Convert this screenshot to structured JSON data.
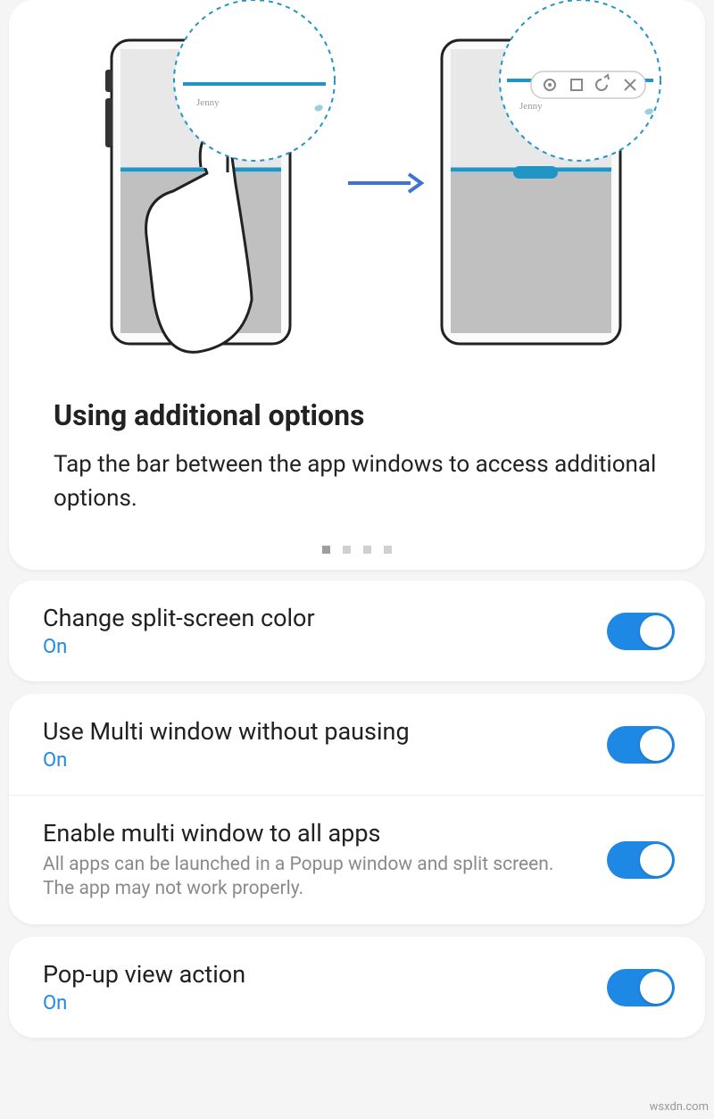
{
  "tip": {
    "title": "Using additional options",
    "description": "Tap the bar between the app windows to access additional options.",
    "pageCount": 4,
    "activeIndex": 0
  },
  "settings": [
    {
      "title": "Change split-screen color",
      "status": "On",
      "sub": "",
      "on": true
    },
    {
      "title": "Use Multi window without pausing",
      "status": "On",
      "sub": "",
      "on": true
    },
    {
      "title": "Enable multi window to all apps",
      "status": "",
      "sub": "All apps can be launched in a Popup window and split screen. The app may not work properly.",
      "on": true
    },
    {
      "title": "Pop-up view action",
      "status": "On",
      "sub": "",
      "on": true
    }
  ],
  "watermark": "wsxdn.com"
}
